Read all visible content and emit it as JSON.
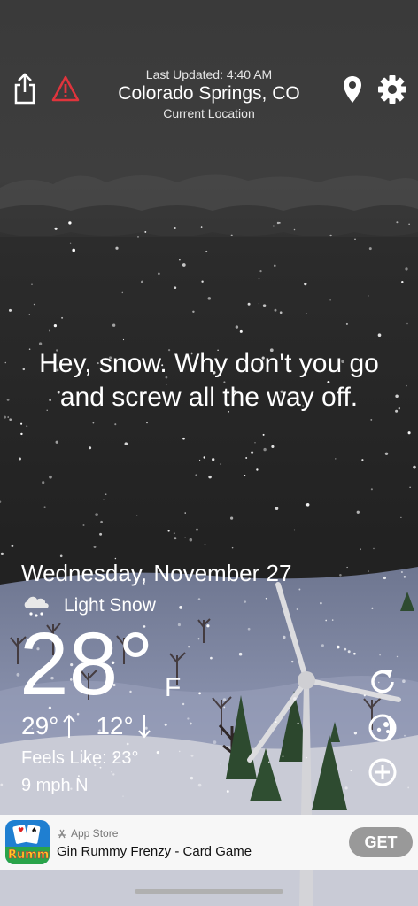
{
  "header": {
    "last_updated": "Last Updated: 4:40 AM",
    "city": "Colorado Springs, CO",
    "location_label": "Current Location",
    "icons": [
      "share-icon",
      "alert-icon",
      "location-pin-icon",
      "settings-icon"
    ]
  },
  "message": "Hey, snow. Why don't you go and screw all the way off.",
  "weather": {
    "date": "Wednesday, November 27",
    "condition": "Light Snow",
    "condition_icon": "cloud-snow-icon",
    "temperature": "28°",
    "unit": "F",
    "high": "29°",
    "low": "12°",
    "feels_like": "Feels Like: 23°",
    "wind": "9 mph N"
  },
  "side_buttons": [
    "refresh-icon",
    "moon-phase-icon",
    "add-icon"
  ],
  "ad": {
    "store_label": "App Store",
    "title": "Gin Rummy Frenzy - Card Game",
    "cta": "GET",
    "icon_text": "Rummy"
  },
  "colors": {
    "sky": "#3c3c3c",
    "night": "#222222",
    "ground": "#8e96b0",
    "snow_ground": "#c8cad6",
    "tree": "#2f4a2f",
    "alert": "#e0343c"
  }
}
